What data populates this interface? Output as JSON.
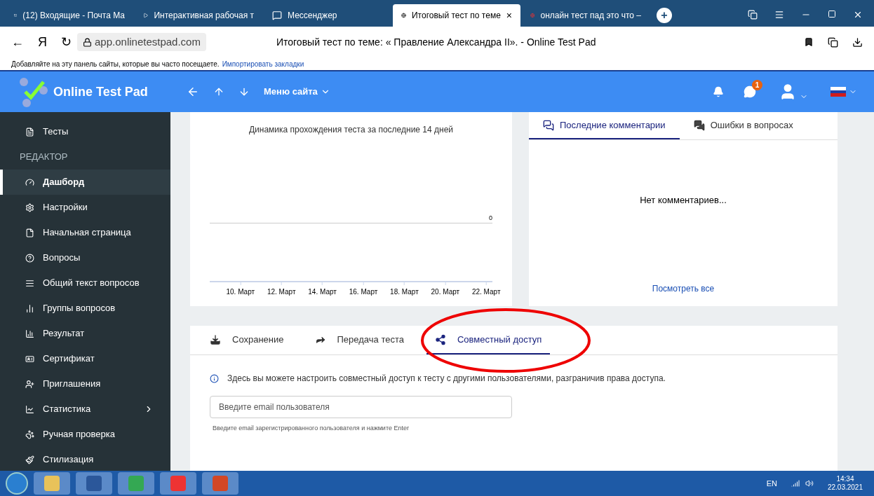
{
  "browser": {
    "tabs": [
      {
        "kind": "mail",
        "label": "(12) Входящие - Почта Ма",
        "selected": false
      },
      {
        "kind": "video",
        "label": "Интерактивная рабочая т",
        "selected": false
      },
      {
        "kind": "chat",
        "label": "Мессенджер",
        "selected": false
      },
      {
        "kind": "site",
        "label": "Итоговый тест по теме",
        "close": "×",
        "selected": true
      },
      {
        "kind": "search",
        "label": "онлайн тест пад это что –",
        "selected": false
      }
    ],
    "new_tab": "+",
    "back": "←",
    "logo": "Я",
    "reload": "↻",
    "url": "app.onlinetestpad.com",
    "page_title": "Итоговый тест по теме: « Правление Александра II». - Online Test Pad",
    "bookmarks_hint": "Добавляйте на эту панель сайты, которые вы часто посещаете.",
    "bookmarks_link": "Импортировать закладки"
  },
  "header": {
    "brand": "Online Test Pad",
    "menu": "Меню сайта",
    "messages_badge": "1"
  },
  "sidebar": {
    "items": [
      {
        "kind": "item",
        "label": "Тесты",
        "selected": false
      },
      {
        "kind": "section",
        "label": "РЕДАКТОР"
      },
      {
        "kind": "item",
        "label": "Дашборд",
        "selected": true
      },
      {
        "kind": "item",
        "label": "Настройки",
        "selected": false
      },
      {
        "kind": "item",
        "label": "Начальная страница",
        "selected": false
      },
      {
        "kind": "item",
        "label": "Вопросы",
        "selected": false
      },
      {
        "kind": "item",
        "label": "Общий текст вопросов",
        "selected": false
      },
      {
        "kind": "item",
        "label": "Группы вопросов",
        "selected": false
      },
      {
        "kind": "item",
        "label": "Результат",
        "selected": false
      },
      {
        "kind": "item",
        "label": "Сертификат",
        "selected": false
      },
      {
        "kind": "item",
        "label": "Приглашения",
        "selected": false
      },
      {
        "kind": "item",
        "label": "Статистика",
        "selected": false,
        "submenu": true
      },
      {
        "kind": "item",
        "label": "Ручная проверка",
        "selected": false
      },
      {
        "kind": "item",
        "label": "Стилизация",
        "selected": false
      }
    ]
  },
  "chart": {
    "title": "Динамика прохождения теста за последние 14 дней",
    "y_label": "0",
    "x_labels": [
      "10. Март",
      "12. Март",
      "14. Март",
      "16. Март",
      "18. Март",
      "20. Март",
      "22. Март"
    ]
  },
  "comments": {
    "tabs": [
      {
        "label": "Последние комментарии",
        "selected": true
      },
      {
        "label": "Ошибки в вопросах",
        "selected": false
      }
    ],
    "empty": "Нет комментариев...",
    "link": "Посмотреть все"
  },
  "sharing": {
    "tabs": [
      {
        "kind": "save",
        "label": "Сохранение",
        "selected": false
      },
      {
        "kind": "transfer",
        "label": "Передача теста",
        "selected": false
      },
      {
        "kind": "share",
        "label": "Совместный доступ",
        "selected": true
      }
    ],
    "info": "Здесь вы можете настроить совместный доступ к тесту с другими пользователями, разграничив права доступа.",
    "email": {
      "placeholder": "Введите email пользователя"
    },
    "hint": "Введите email зарегистрированного пользователя и нажмите Enter"
  },
  "taskbar": {
    "language": "EN",
    "time": "14:34",
    "date": "22.03.2021"
  }
}
